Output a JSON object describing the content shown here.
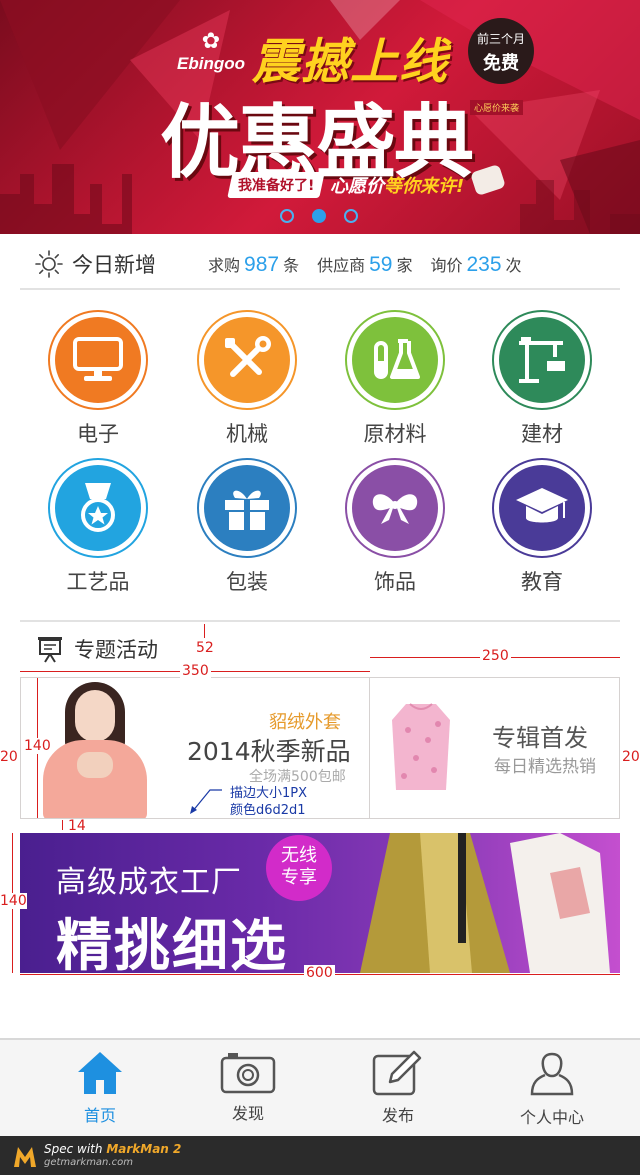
{
  "banner": {
    "logo_text": "Ebingoo",
    "headline": "震撼上线",
    "title": "优惠盛典",
    "badge_line1": "前三个月",
    "badge_line2": "免费",
    "small_tag": "心愿价来袭",
    "slogan_ready": "我准备好了!",
    "slogan_main_a": "心愿价",
    "slogan_main_b": "等你来许!",
    "slides": 3,
    "active_slide": 1
  },
  "stats": {
    "title": "今日新增",
    "items": [
      {
        "label": "求购",
        "value": "987",
        "unit": "条"
      },
      {
        "label": "供应商",
        "value": "59",
        "unit": "家"
      },
      {
        "label": "询价",
        "value": "235",
        "unit": "次"
      }
    ]
  },
  "categories": [
    {
      "label": "电子",
      "icon": "monitor-icon",
      "color": "#f07a22"
    },
    {
      "label": "机械",
      "icon": "wrench-screwdriver-icon",
      "color": "#f5962a"
    },
    {
      "label": "原材料",
      "icon": "flask-icon",
      "color": "#7ec13c"
    },
    {
      "label": "建材",
      "icon": "crane-icon",
      "color": "#2e8a5a"
    },
    {
      "label": "工艺品",
      "icon": "medal-icon",
      "color": "#22a4e0"
    },
    {
      "label": "包装",
      "icon": "gift-icon",
      "color": "#2c7fc0"
    },
    {
      "label": "饰品",
      "icon": "bow-icon",
      "color": "#8a4fa6"
    },
    {
      "label": "教育",
      "icon": "graduation-cap-icon",
      "color": "#4a3b98"
    }
  ],
  "topic": {
    "title": "专题活动",
    "card_left": {
      "tag": "貂绒外套",
      "title": "2014秋季新品",
      "sub": "全场满500包邮"
    },
    "card_right": {
      "title": "专辑首发",
      "sub": "每日精选热销"
    },
    "banner2": {
      "line1": "高级成衣工厂",
      "line2": "精挑细选",
      "badge1": "无线",
      "badge2": "专享"
    }
  },
  "annotations": {
    "gap_52": "52",
    "w_350": "350",
    "w_250": "250",
    "h_140_a": "140",
    "side_20_left": "20",
    "side_20_right": "20",
    "gap_14": "14",
    "h_140_b": "140",
    "w_600": "600",
    "note_line1": "描边大小1PX",
    "note_line2": "颜色d6d2d1"
  },
  "tabs": [
    {
      "label": "首页",
      "icon": "home-icon",
      "active": true
    },
    {
      "label": "发现",
      "icon": "camera-icon",
      "active": false
    },
    {
      "label": "发布",
      "icon": "edit-icon",
      "active": false
    },
    {
      "label": "个人中心",
      "icon": "user-icon",
      "active": false
    }
  ],
  "footer": {
    "brand_a": "Spec with ",
    "brand_b": "MarkMan 2",
    "url": "getmarkman.com"
  },
  "colors": {
    "accent": "#2ca0ea",
    "annotation": "#d91e1e",
    "border": "#d6d2d1"
  }
}
